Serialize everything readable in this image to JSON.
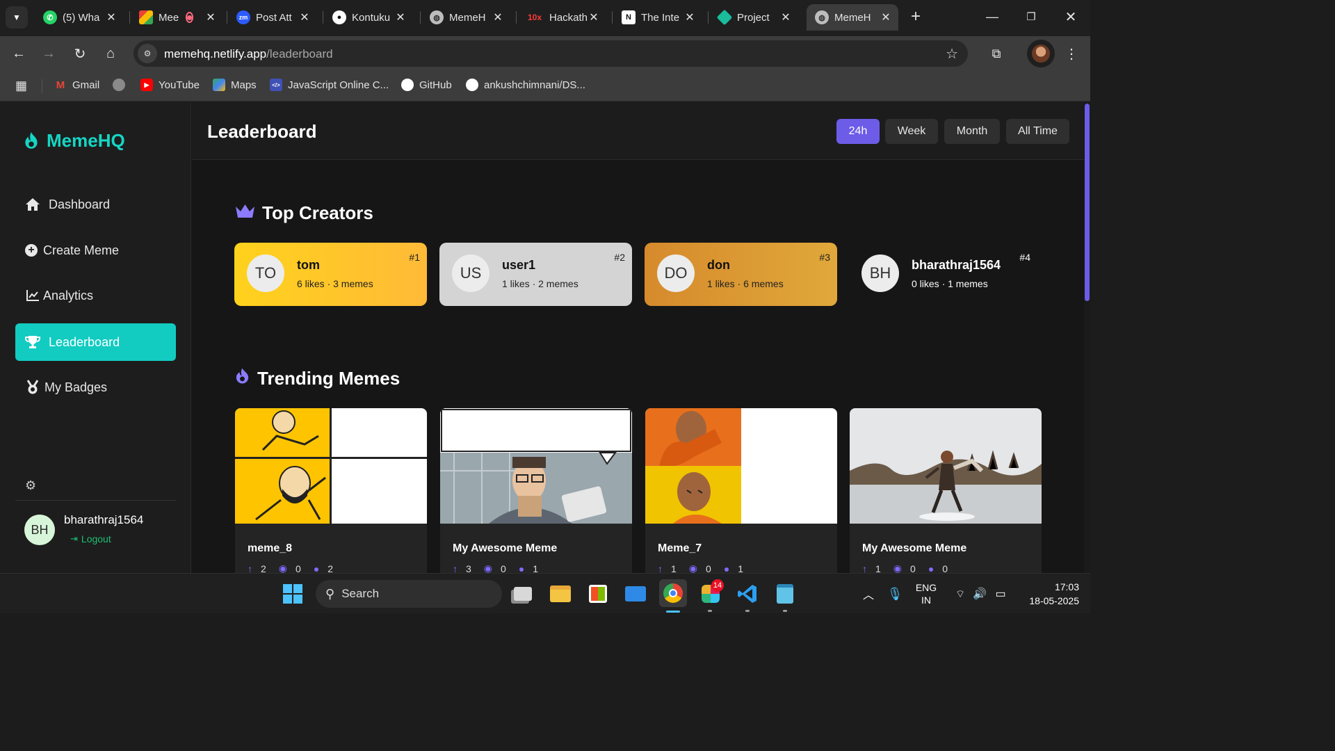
{
  "browser": {
    "tabs": [
      {
        "label": "(5) Wha",
        "favicon": "whatsapp-icon",
        "color": "#25d366"
      },
      {
        "label": "Mee",
        "favicon": "google-meet-icon",
        "color": "#00897b"
      },
      {
        "label": "Post Att",
        "favicon": "zoom-icon",
        "color": "#2d5bff",
        "fav_text": "zm"
      },
      {
        "label": "Kontuku",
        "favicon": "github-icon",
        "color": "#ffffff"
      },
      {
        "label": "MemeH",
        "favicon": "globe-icon",
        "color": "#cccccc"
      },
      {
        "label": "Hackath",
        "favicon": "10x-icon",
        "color": "#e53935",
        "fav_text": "10x"
      },
      {
        "label": "The Inte",
        "favicon": "notion-icon",
        "color": "#ffffff",
        "fav_text": "N"
      },
      {
        "label": "Project",
        "favicon": "diamond-icon",
        "color": "#1abc9c"
      },
      {
        "label": "MemeH",
        "favicon": "globe-icon",
        "color": "#cccccc"
      }
    ],
    "url_host": "memehq.netlify.app",
    "url_path": "/leaderboard",
    "bookmarks": [
      {
        "label": "Gmail",
        "icon": "gmail-icon",
        "color": "#ea4335",
        "glyph": "M"
      },
      {
        "label": "",
        "icon": "globe-icon",
        "color": "#9a9a9a",
        "glyph": ""
      },
      {
        "label": "YouTube",
        "icon": "youtube-icon",
        "color": "#ff0000",
        "glyph": "▶"
      },
      {
        "label": "Maps",
        "icon": "maps-icon",
        "color": "#34a853",
        "glyph": "◆"
      },
      {
        "label": "JavaScript Online C...",
        "icon": "code-icon",
        "color": "#5c6bc0",
        "glyph": "</>"
      },
      {
        "label": "GitHub",
        "icon": "github-icon",
        "color": "#ffffff",
        "glyph": ""
      },
      {
        "label": "ankushchimnani/DS...",
        "icon": "github-icon",
        "color": "#ffffff",
        "glyph": ""
      }
    ]
  },
  "app": {
    "brand": "MemeHQ",
    "nav": [
      {
        "label": "Dashboard",
        "icon": "home-icon"
      },
      {
        "label": "Create Meme",
        "icon": "plus-circle-icon"
      },
      {
        "label": "Analytics",
        "icon": "chart-line-icon"
      },
      {
        "label": "Leaderboard",
        "icon": "trophy-icon",
        "active": true
      },
      {
        "label": "My Badges",
        "icon": "medal-icon"
      }
    ],
    "user": {
      "initials": "BH",
      "name": "bharathraj1564",
      "logout": "Logout"
    },
    "page_title": "Leaderboard",
    "filters": [
      {
        "label": "24h",
        "active": true
      },
      {
        "label": "Week"
      },
      {
        "label": "Month"
      },
      {
        "label": "All Time"
      }
    ],
    "top_creators": {
      "title": "Top Creators",
      "items": [
        {
          "initials": "TO",
          "name": "tom",
          "stats": "6 likes · 3 memes",
          "rank": "#1"
        },
        {
          "initials": "US",
          "name": "user1",
          "stats": "1 likes · 2 memes",
          "rank": "#2"
        },
        {
          "initials": "DO",
          "name": "don",
          "stats": "1 likes · 6 memes",
          "rank": "#3"
        },
        {
          "initials": "BH",
          "name": "bharathraj1564",
          "stats": "0 likes · 1 memes",
          "rank": "#4"
        }
      ]
    },
    "trending": {
      "title": "Trending Memes",
      "items": [
        {
          "title": "meme_8",
          "upvotes": "2",
          "views": "0",
          "comments": "2"
        },
        {
          "title": "My Awesome Meme",
          "upvotes": "3",
          "views": "0",
          "comments": "1"
        },
        {
          "title": "Meme_7",
          "upvotes": "1",
          "views": "0",
          "comments": "1"
        },
        {
          "title": "My Awesome Meme",
          "upvotes": "1",
          "views": "0",
          "comments": "0"
        }
      ]
    },
    "colors": {
      "accent": "#15d6c4",
      "purple": "#6c5ce7",
      "gold": "#ffc41f",
      "silver": "#d4d4d4",
      "bronze": "#d9962a"
    }
  },
  "taskbar": {
    "search_label": "Search",
    "lang_line1": "ENG",
    "lang_line2": "IN",
    "time": "17:03",
    "date": "18-05-2025",
    "slack_badge": "14"
  }
}
